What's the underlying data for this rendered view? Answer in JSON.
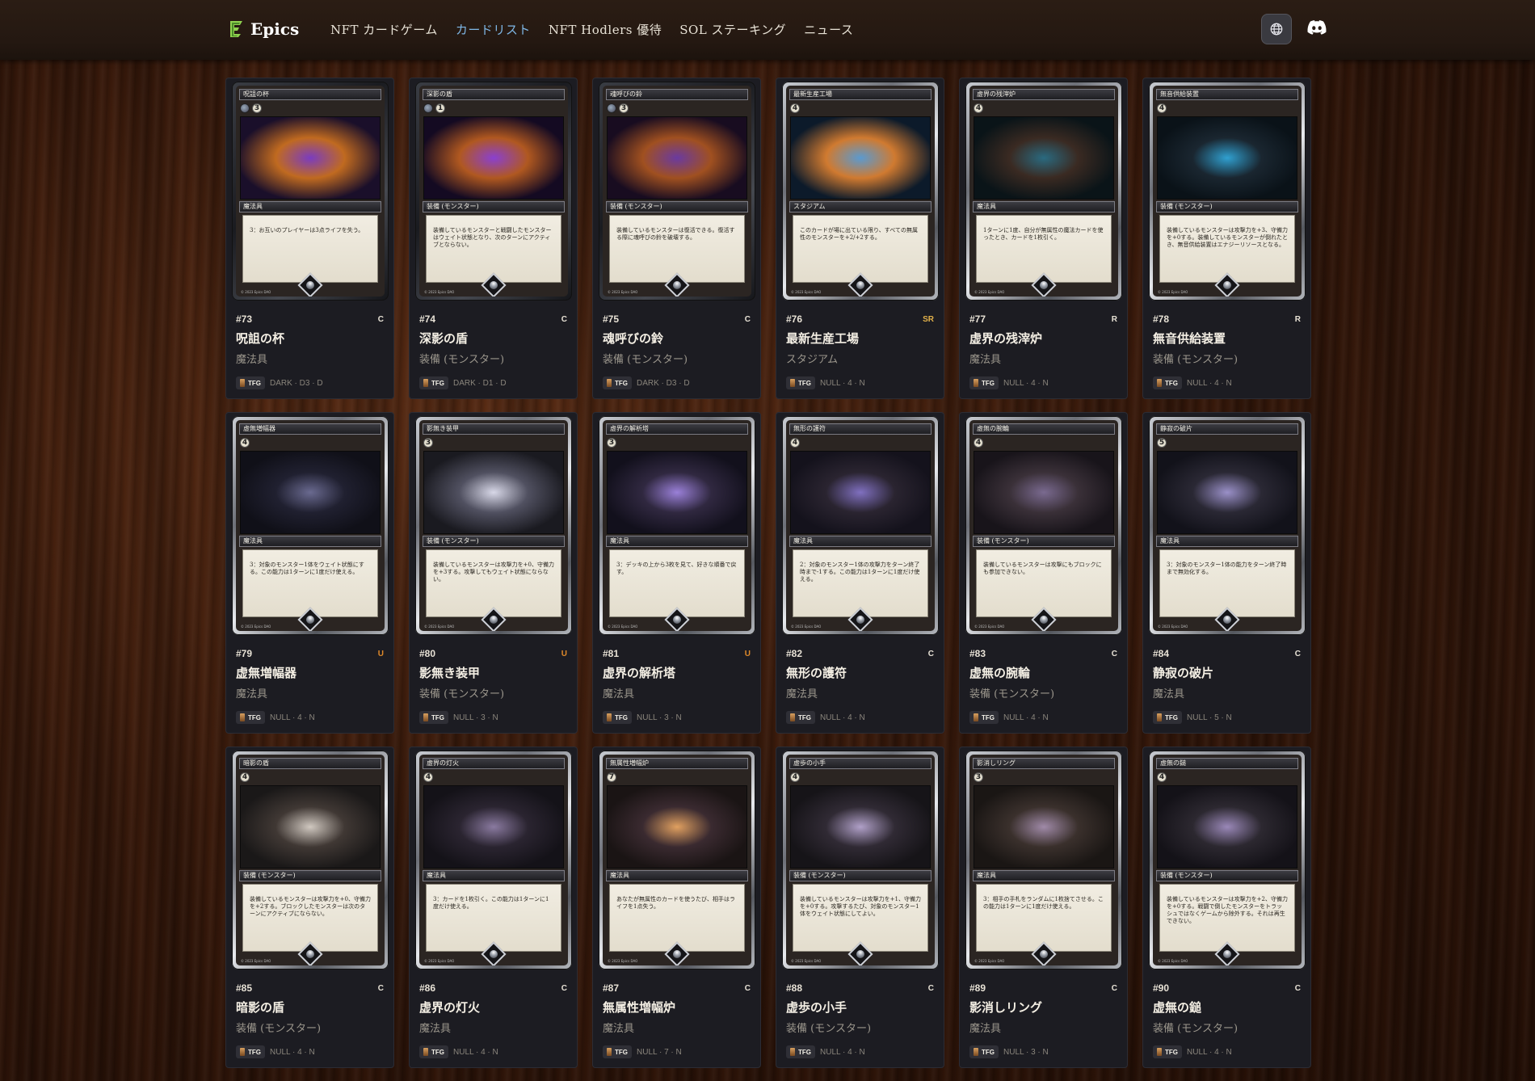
{
  "header": {
    "logo_text": "Epics",
    "nav": [
      {
        "label": "NFT カードゲーム"
      },
      {
        "label": "カードリスト"
      },
      {
        "label": "NFT Hodlers 優待"
      },
      {
        "label": "SOL ステーキング"
      },
      {
        "label": "ニュース"
      }
    ],
    "active_nav_index": 1,
    "icons": [
      "globe-icon",
      "discord-icon"
    ]
  },
  "cards": [
    {
      "num": "#73",
      "rarity": "C",
      "name": "呪詛の杯",
      "type": "魔法具",
      "set": "TFG",
      "attrs": "DARK · D3 · D",
      "card_title": "呪詛の杯",
      "cost": "3",
      "dark": true,
      "card_type": "魔法具",
      "text": "3：お互いのプレイヤーは3点ライフを失う。",
      "art": [
        "#1a0f2a",
        "#7a3cc0",
        "#c06a20"
      ]
    },
    {
      "num": "#74",
      "rarity": "C",
      "name": "深影の盾",
      "type": "装備 (モンスター)",
      "set": "TFG",
      "attrs": "DARK · D1 · D",
      "card_title": "深影の盾",
      "cost": "1",
      "dark": true,
      "card_type": "装備 (モンスター)",
      "text": "装備しているモンスターと戦闘したモンスターはウェイト状態となり、次のターンにアクティブとならない。",
      "art": [
        "#140a22",
        "#8a40d0",
        "#b05820"
      ]
    },
    {
      "num": "#75",
      "rarity": "C",
      "name": "魂呼びの鈴",
      "type": "装備 (モンスター)",
      "set": "TFG",
      "attrs": "DARK · D3 · D",
      "card_title": "魂呼びの鈴",
      "cost": "3",
      "dark": true,
      "card_type": "装備 (モンスター)",
      "text": "装備しているモンスターは復活できる。復活する際に魂呼びの鈴を破壊する。",
      "art": [
        "#180c20",
        "#6a3aa0",
        "#a05020"
      ]
    },
    {
      "num": "#76",
      "rarity": "SR",
      "name": "最新生産工場",
      "type": "スタジアム",
      "set": "TFG",
      "attrs": "NULL · 4 · N",
      "card_title": "最新生産工場",
      "cost": "4",
      "dark": false,
      "card_type": "スタジアム",
      "text": "このカードが場に出ている限り、すべての無属性のモンスターを+2/+2する。",
      "art": [
        "#0c1a2a",
        "#5a9ad0",
        "#d07a30"
      ]
    },
    {
      "num": "#77",
      "rarity": "R",
      "name": "虚界の残滓炉",
      "type": "魔法具",
      "set": "TFG",
      "attrs": "NULL · 4 · N",
      "card_title": "虚界の残滓炉",
      "cost": "4",
      "dark": false,
      "card_type": "魔法具",
      "text": "1ターンに1度、自分が無属性の魔法カードを使ったとき、カードを1枚引く。",
      "art": [
        "#0a1418",
        "#2a6a80",
        "#3a2a22"
      ]
    },
    {
      "num": "#78",
      "rarity": "R",
      "name": "無音供給装置",
      "type": "装備 (モンスター)",
      "set": "TFG",
      "attrs": "NULL · 4 · N",
      "card_title": "無音供給装置",
      "cost": "4",
      "dark": false,
      "card_type": "装備 (モンスター)",
      "text": "装備しているモンスターは攻撃力を+3、守備力を+0する。装備しているモンスターが倒れたとき、無音供給装置はエナジーリソースとなる。",
      "art": [
        "#0a1218",
        "#30a0d0",
        "#1a2630"
      ]
    },
    {
      "num": "#79",
      "rarity": "U",
      "name": "虚無増幅器",
      "type": "魔法具",
      "set": "TFG",
      "attrs": "NULL · 4 · N",
      "card_title": "虚無増幅器",
      "cost": "4",
      "dark": false,
      "card_type": "魔法具",
      "text": "3：対象のモンスター1体をウェイト状態にする。この能力は1ターンに1度だけ使える。",
      "art": [
        "#101018",
        "#6a6a90",
        "#202030"
      ]
    },
    {
      "num": "#80",
      "rarity": "U",
      "name": "影無き装甲",
      "type": "装備 (モンスター)",
      "set": "TFG",
      "attrs": "NULL · 3 · N",
      "card_title": "影無き装甲",
      "cost": "3",
      "dark": false,
      "card_type": "装備 (モンスター)",
      "text": "装備しているモンスターは攻撃力を+0、守備力を+3する。攻撃してもウェイト状態にならない。",
      "art": [
        "#1a1a20",
        "#d8d8e8",
        "#505060"
      ]
    },
    {
      "num": "#81",
      "rarity": "U",
      "name": "虚界の解析塔",
      "type": "魔法具",
      "set": "TFG",
      "attrs": "NULL · 3 · N",
      "card_title": "虚界の解析塔",
      "cost": "3",
      "dark": false,
      "card_type": "魔法具",
      "text": "3：デッキの上から3枚を見て、好きな順番で戻す。",
      "art": [
        "#12101c",
        "#9a80d8",
        "#302840"
      ]
    },
    {
      "num": "#82",
      "rarity": "C",
      "name": "無形の護符",
      "type": "魔法具",
      "set": "TFG",
      "attrs": "NULL · 4 · N",
      "card_title": "無形の護符",
      "cost": "4",
      "dark": false,
      "card_type": "魔法具",
      "text": "2：対象のモンスター1体の攻撃力をターン終了時まで-1する。この能力は1ターンに1度だけ使える。",
      "art": [
        "#14121c",
        "#8070c0",
        "#2a2430"
      ]
    },
    {
      "num": "#83",
      "rarity": "C",
      "name": "虚無の腕輪",
      "type": "装備 (モンスター)",
      "set": "TFG",
      "attrs": "NULL · 4 · N",
      "card_title": "虚無の腕輪",
      "cost": "4",
      "dark": false,
      "card_type": "装備 (モンスター)",
      "text": "装備しているモンスターは攻撃にもブロックにも参加できない。",
      "art": [
        "#18141a",
        "#7a6a90",
        "#3a3038"
      ]
    },
    {
      "num": "#84",
      "rarity": "C",
      "name": "静寂の破片",
      "type": "魔法具",
      "set": "TFG",
      "attrs": "NULL · 5 · N",
      "card_title": "静寂の破片",
      "cost": "5",
      "dark": false,
      "card_type": "魔法具",
      "text": "3：対象のモンスター1体の能力をターン終了時まで無効化する。",
      "art": [
        "#12121a",
        "#9a90c8",
        "#2a2834"
      ]
    },
    {
      "num": "#85",
      "rarity": "C",
      "name": "暗影の盾",
      "type": "装備 (モンスター)",
      "set": "TFG",
      "attrs": "NULL · 4 · N",
      "card_title": "暗影の盾",
      "cost": "4",
      "dark": false,
      "card_type": "装備 (モンスター)",
      "text": "装備しているモンスターは攻撃力を+0、守備力を+2する。ブロックしたモンスターは次のターンにアクティブにならない。",
      "art": [
        "#1a1818",
        "#d0c8c0",
        "#403834"
      ]
    },
    {
      "num": "#86",
      "rarity": "C",
      "name": "虚界の灯火",
      "type": "魔法具",
      "set": "TFG",
      "attrs": "NULL · 4 · N",
      "card_title": "虚界の灯火",
      "cost": "4",
      "dark": false,
      "card_type": "魔法具",
      "text": "3：カードを1枚引く。この能力は1ターンに1度だけ使える。",
      "art": [
        "#141218",
        "#8a7aa0",
        "#2a2430"
      ]
    },
    {
      "num": "#87",
      "rarity": "C",
      "name": "無属性増幅炉",
      "type": "魔法具",
      "set": "TFG",
      "attrs": "NULL · 7 · N",
      "card_title": "無属性増幅炉",
      "cost": "7",
      "dark": false,
      "card_type": "魔法具",
      "text": "あなたが無属性のカードを使うたび、相手はライフを1点失う。",
      "art": [
        "#1a1414",
        "#e0a060",
        "#3a2a30"
      ]
    },
    {
      "num": "#88",
      "rarity": "C",
      "name": "虚歩の小手",
      "type": "装備 (モンスター)",
      "set": "TFG",
      "attrs": "NULL · 4 · N",
      "card_title": "虚歩の小手",
      "cost": "4",
      "dark": false,
      "card_type": "装備 (モンスター)",
      "text": "装備しているモンスターは攻撃力を+1、守備力を+0する。攻撃するたび、対象のモンスター1体をウェイト状態にしてよい。",
      "art": [
        "#161418",
        "#b0a0c8",
        "#302a34"
      ]
    },
    {
      "num": "#89",
      "rarity": "C",
      "name": "影消しリング",
      "type": "魔法具",
      "set": "TFG",
      "attrs": "NULL · 3 · N",
      "card_title": "影消しリング",
      "cost": "3",
      "dark": false,
      "card_type": "魔法具",
      "text": "3：相手の手札をランダムに1枚捨てさせる。この能力は1ターンに1度だけ使える。",
      "art": [
        "#1a1614",
        "#a08aa8",
        "#3a302c"
      ]
    },
    {
      "num": "#90",
      "rarity": "C",
      "name": "虚無の鎚",
      "type": "装備 (モンスター)",
      "set": "TFG",
      "attrs": "NULL · 4 · N",
      "card_title": "虚無の鎚",
      "cost": "4",
      "dark": false,
      "card_type": "装備 (モンスター)",
      "text": "装備しているモンスターは攻撃力を+2、守備力を+0する。戦闘で倒したモンスターをトラッシュではなくゲームから除外する。それは再生できない。",
      "art": [
        "#141218",
        "#9a88b8",
        "#2c2830"
      ]
    }
  ],
  "card_footer": "© 2023 Epics DAO",
  "colors": {
    "accent_nav": "#7fb7e6",
    "rarity_sr": "#e0b04a",
    "rarity_u": "#e08a2a",
    "tile_bg": "#1c1c22"
  }
}
